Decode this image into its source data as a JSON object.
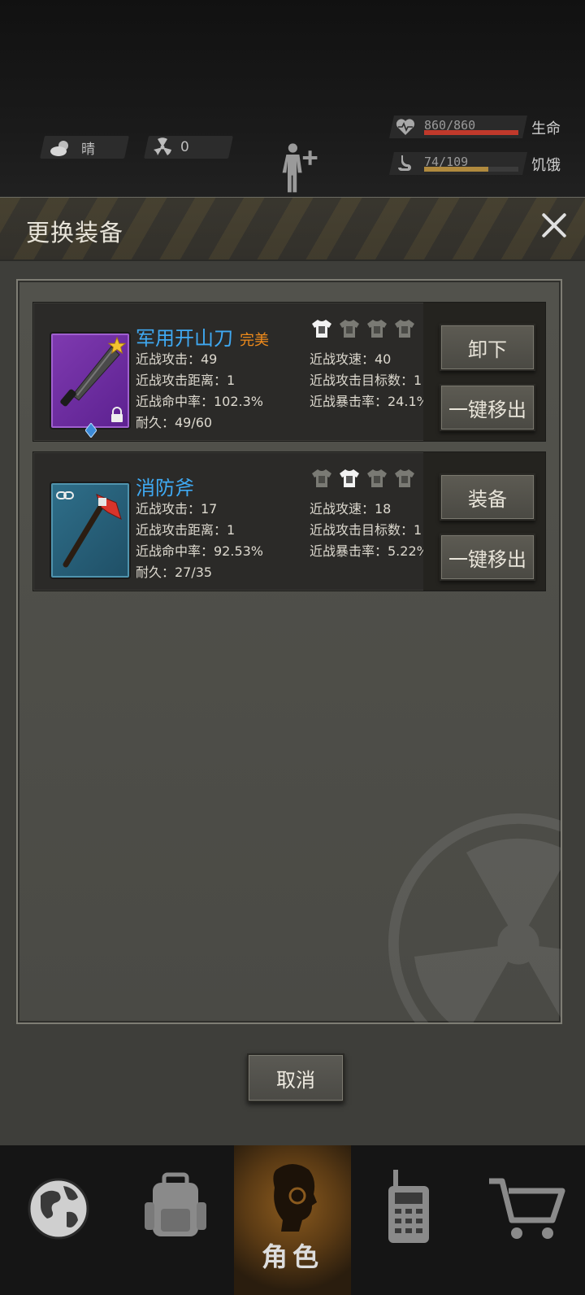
{
  "hud": {
    "weather": "晴",
    "radiation": "0",
    "health": {
      "text": "860/860",
      "label": "生命",
      "fraction": 1.0,
      "color": "#c0392b"
    },
    "hunger": {
      "text": "74/109",
      "label": "饥饿",
      "fraction": 0.68,
      "color": "#b08a3e"
    }
  },
  "dialog": {
    "title": "更换装备",
    "cancel_label": "取消",
    "items": [
      {
        "name": "军用开山刀",
        "quality": "完美",
        "stats_left": [
          "近战攻击：49",
          "近战攻击距离：1",
          "近战命中率：102.3%",
          "耐久：49/60"
        ],
        "stats_right": [
          "近战攻速：40",
          "近战攻击目标数：1",
          "近战暴击率：24.1%"
        ],
        "active_tier": 1,
        "button_primary": "卸下",
        "button_secondary": "一键移出"
      },
      {
        "name": "消防斧",
        "quality": "",
        "stats_left": [
          "近战攻击：17",
          "近战攻击距离：1",
          "近战命中率：92.53%",
          "耐久：27/35"
        ],
        "stats_right": [
          "近战攻速：18",
          "近战攻击目标数：1",
          "近战暴击率：5.22%"
        ],
        "active_tier": 2,
        "button_primary": "装备",
        "button_secondary": "一键移出"
      }
    ]
  },
  "nav": {
    "items": [
      {
        "name": "world",
        "icon": "globe-icon"
      },
      {
        "name": "backpack",
        "icon": "backpack-icon"
      },
      {
        "name": "character",
        "icon": "head-icon",
        "label": "角色",
        "active": true
      },
      {
        "name": "radio",
        "icon": "walkie-talkie-icon"
      },
      {
        "name": "shop",
        "icon": "cart-icon"
      }
    ]
  }
}
